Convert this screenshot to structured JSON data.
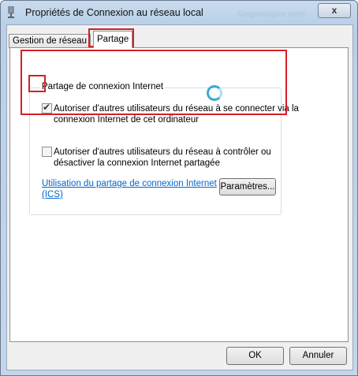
{
  "window": {
    "title": "Propriétés de Connexion au réseau local",
    "ghost_text": "Diagnostiquer cette",
    "close_label": "x"
  },
  "tabs": [
    {
      "label": "Gestion de réseau",
      "active": false
    },
    {
      "label": "Partage",
      "active": true
    }
  ],
  "sharing": {
    "group_title": "Partage de connexion Internet",
    "allow_connect": {
      "checked": true,
      "line1": "Autoriser d'autres utilisateurs du réseau à se connecter via la",
      "line2": "connexion Internet de cet ordinateur"
    },
    "allow_control": {
      "checked": false,
      "line1": "Autoriser d'autres utilisateurs du réseau à contrôler ou",
      "line2": "désactiver la connexion Internet partagée"
    },
    "ics_link_line1": "Utilisation du partage de connexion Internet",
    "ics_link_line2": "(ICS)",
    "settings_button": "Paramètres..."
  },
  "footer": {
    "ok_label": "OK",
    "cancel_label": "Annuler"
  },
  "colors": {
    "highlight": "#d61f26",
    "link": "#0066cc",
    "spinner": "#3fa7d6"
  }
}
